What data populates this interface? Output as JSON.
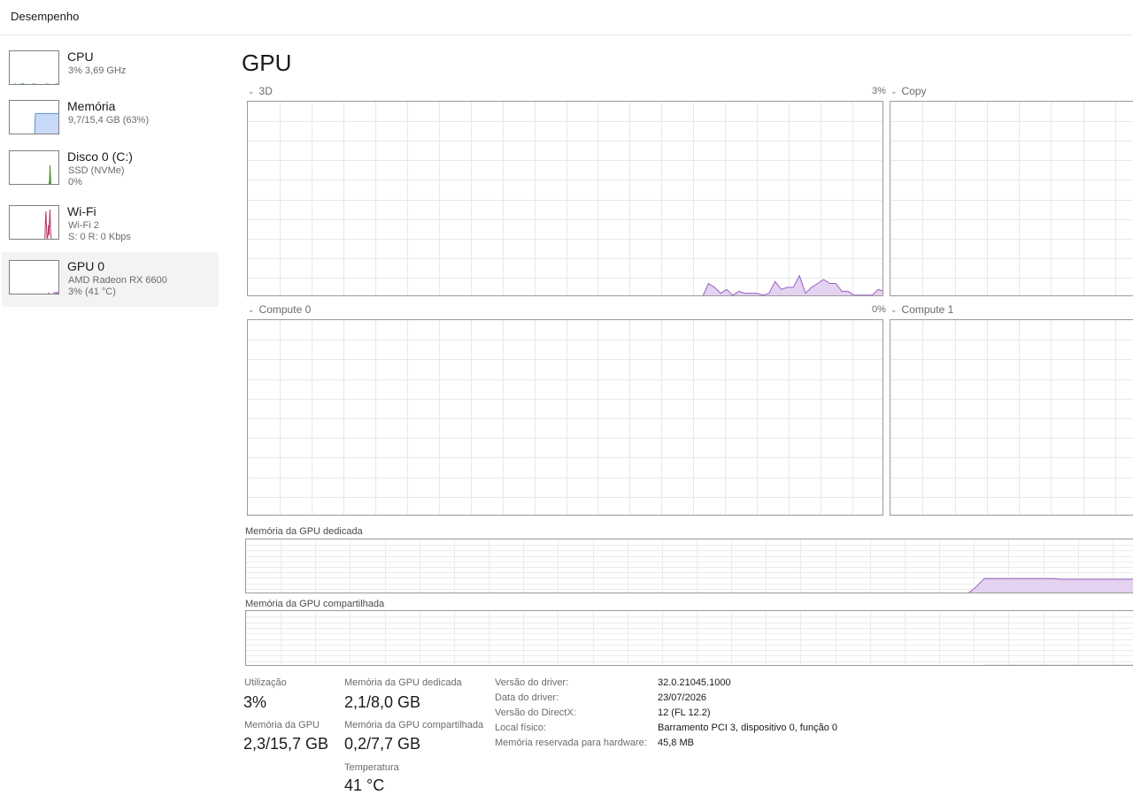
{
  "header": {
    "title": "Desempenho"
  },
  "sidebar": {
    "items": [
      {
        "name": "CPU",
        "sub1": "3% 3,69 GHz",
        "sub2": ""
      },
      {
        "name": "Memória",
        "sub1": "9,7/15,4 GB (63%)",
        "sub2": ""
      },
      {
        "name": "Disco 0 (C:)",
        "sub1": "SSD (NVMe)",
        "sub2": "0%"
      },
      {
        "name": "Wi-Fi",
        "sub1": "Wi-Fi 2",
        "sub2": "S: 0 R: 0 Kbps"
      },
      {
        "name": "GPU 0",
        "sub1": "AMD Radeon RX 6600",
        "sub2": "3% (41 °C)"
      }
    ]
  },
  "main": {
    "title": "GPU",
    "engines": [
      {
        "label": "3D",
        "percent": "3%"
      },
      {
        "label": "Copy",
        "percent": ""
      },
      {
        "label": "Compute 0",
        "percent": "0%"
      },
      {
        "label": "Compute 1",
        "percent": ""
      }
    ],
    "memory_graphs": {
      "dedicated_label": "Memória da GPU dedicada",
      "shared_label": "Memória da GPU compartilhada"
    }
  },
  "stats": {
    "utilization_label": "Utilização",
    "utilization_value": "3%",
    "dedicated_label": "Memória da GPU dedicada",
    "dedicated_value": "2,1/8,0 GB",
    "gpu_memory_label": "Memória da GPU",
    "gpu_memory_value": "2,3/15,7 GB",
    "shared_label": "Memória da GPU compartilhada",
    "shared_value": "0,2/7,7 GB",
    "temperature_label": "Temperatura",
    "temperature_value": "41 °C"
  },
  "info": [
    {
      "key": "Versão do driver:",
      "value": "32.0.21045.1000"
    },
    {
      "key": "Data do driver:",
      "value": "23/07/2026"
    },
    {
      "key": "Versão do DirectX:",
      "value": "12 (FL 12.2)"
    },
    {
      "key": "Local físico:",
      "value": "Barramento PCI 3, dispositivo 0, função 0"
    },
    {
      "key": "Memória reservada para hardware:",
      "value": "45,8 MB"
    }
  ],
  "history": {
    "gpu_3d_percent": [
      0,
      0,
      0,
      0,
      0,
      0,
      0,
      0,
      0,
      0,
      0,
      0,
      0,
      0,
      0,
      0,
      0,
      0,
      0,
      0,
      0,
      0,
      0,
      0,
      0,
      0,
      0,
      0,
      0,
      0,
      0,
      0,
      0,
      0,
      0,
      0,
      0,
      0,
      0,
      0,
      0,
      0,
      0,
      0,
      0,
      0,
      0,
      0,
      0,
      0,
      0,
      0,
      0,
      0,
      0,
      0,
      0,
      0,
      0,
      0,
      0,
      0,
      0,
      0,
      0,
      0,
      0,
      0,
      0,
      0,
      0,
      0,
      0,
      0,
      0,
      0,
      7,
      5,
      2,
      4,
      1,
      3,
      2,
      2,
      2,
      1,
      2,
      8,
      4,
      5,
      5,
      11,
      2,
      5,
      7,
      9,
      7,
      7,
      3,
      3,
      1,
      1,
      1,
      1,
      4,
      3
    ],
    "dedicated_memory_gb": [
      0,
      0,
      0,
      0,
      0,
      0,
      0,
      0,
      0,
      0,
      0,
      0,
      0,
      0,
      0,
      0,
      0,
      0,
      0,
      0,
      0,
      0,
      0,
      0,
      0,
      0,
      0,
      0,
      0,
      0,
      0,
      0,
      0,
      0,
      0,
      0,
      0,
      0,
      0,
      0,
      0,
      0,
      0,
      0,
      0,
      0,
      0,
      0,
      0,
      0,
      0,
      0,
      0,
      0,
      0,
      0,
      0,
      0,
      0,
      0,
      0,
      0,
      0,
      0,
      0,
      0,
      0,
      0,
      0,
      0,
      0,
      0,
      0,
      0,
      0,
      0,
      0,
      0,
      0,
      0,
      0,
      0,
      0,
      0,
      0,
      1,
      2.3,
      2.3,
      2.3,
      2.3,
      2.3,
      2.3,
      2.3,
      2.3,
      2.3,
      2.2,
      2.2,
      2.2,
      2.2,
      2.2,
      2.2,
      2.2,
      2.2,
      2.2,
      2.2,
      2.1
    ],
    "shared_memory_gb": [
      0,
      0,
      0,
      0,
      0,
      0,
      0,
      0,
      0,
      0,
      0,
      0,
      0,
      0,
      0,
      0,
      0,
      0,
      0,
      0,
      0,
      0,
      0,
      0,
      0,
      0,
      0,
      0,
      0,
      0,
      0,
      0,
      0,
      0,
      0,
      0,
      0,
      0,
      0,
      0,
      0,
      0,
      0,
      0,
      0,
      0,
      0,
      0,
      0,
      0,
      0,
      0,
      0,
      0,
      0,
      0,
      0,
      0,
      0,
      0,
      0,
      0,
      0,
      0,
      0,
      0,
      0,
      0,
      0,
      0,
      0,
      0,
      0,
      0,
      0,
      0,
      0,
      0,
      0,
      0,
      0,
      0,
      0,
      0,
      0,
      0,
      0.2,
      0.2,
      0.2,
      0.2,
      0.2,
      0.2,
      0.2,
      0.2,
      0.2,
      0.2,
      0.2,
      0.2,
      0.2,
      0.2,
      0.2,
      0.2,
      0.2,
      0.2,
      0.2,
      0.2
    ],
    "thumb_cpu_percent": [
      4,
      3,
      5,
      3,
      4,
      6,
      3,
      4,
      3,
      5,
      4,
      3,
      4,
      3,
      5,
      4,
      3,
      4,
      5,
      3
    ],
    "thumb_memory_percent": [
      0,
      0,
      0,
      0,
      0,
      0,
      0,
      0,
      0,
      0,
      0,
      0,
      0,
      0,
      0,
      0,
      0,
      0,
      0,
      0,
      0,
      0,
      0,
      0,
      0,
      0,
      0,
      0,
      0,
      0,
      63,
      63,
      63,
      63,
      63,
      63,
      63,
      63,
      63,
      63,
      63,
      63,
      63,
      63,
      63,
      63,
      63,
      63,
      63,
      63,
      63,
      63,
      63,
      63,
      63,
      63,
      63,
      63,
      63,
      63
    ],
    "thumb_disk_percent": [
      0,
      0,
      0,
      0,
      0,
      0,
      0,
      0,
      0,
      0,
      0,
      0,
      0,
      0,
      0,
      0,
      0,
      0,
      0,
      0,
      0,
      0,
      0,
      0,
      0,
      0,
      0,
      0,
      0,
      0,
      0,
      0,
      0,
      0,
      0,
      0,
      0,
      0,
      0,
      0,
      0,
      0,
      0,
      0,
      0,
      0,
      0,
      0,
      0,
      0,
      0,
      0,
      0,
      0,
      0,
      0,
      0,
      0,
      0,
      0,
      0,
      0,
      0,
      0,
      0,
      0,
      0,
      0,
      0,
      0,
      0,
      0,
      0,
      0,
      0,
      0,
      0,
      5,
      15,
      60,
      30,
      3,
      0,
      0,
      0,
      0,
      0,
      0,
      0,
      0,
      0,
      0,
      0,
      0,
      0,
      0,
      0,
      0,
      0,
      0
    ],
    "thumb_wifi_percent": [
      0,
      0,
      0,
      0,
      0,
      0,
      0,
      0,
      0,
      0,
      0,
      0,
      0,
      0,
      0,
      0,
      0,
      0,
      0,
      0,
      0,
      0,
      0,
      0,
      0,
      0,
      0,
      0,
      0,
      0,
      0,
      0,
      0,
      0,
      0,
      0,
      0,
      0,
      0,
      0,
      0,
      0,
      0,
      0,
      0,
      0,
      0,
      0,
      0,
      0,
      0,
      0,
      0,
      0,
      0,
      0,
      0,
      0,
      0,
      0,
      0,
      0,
      0,
      0,
      0,
      0,
      0,
      0,
      0,
      0,
      55,
      85,
      40,
      10,
      5,
      20,
      45,
      15,
      60,
      90,
      30,
      10,
      5,
      0,
      0,
      0,
      0,
      0,
      0,
      0,
      0,
      0,
      0,
      0,
      0,
      0,
      0,
      0,
      0,
      0
    ],
    "thumb_gpu_percent": [
      0,
      0,
      0,
      0,
      0,
      0,
      0,
      0,
      0,
      0,
      0,
      0,
      0,
      0,
      0,
      0,
      0,
      0,
      0,
      0,
      0,
      0,
      0,
      0,
      0,
      0,
      0,
      0,
      0,
      0,
      0,
      0,
      0,
      0,
      0,
      0,
      0,
      0,
      0,
      0,
      0,
      0,
      0,
      0,
      0,
      0,
      0,
      0,
      0,
      0,
      0,
      0,
      0,
      0,
      0,
      0,
      0,
      0,
      0,
      0,
      0,
      0,
      0,
      0,
      0,
      0,
      0,
      0,
      0,
      0,
      0,
      0,
      0,
      0,
      0,
      0,
      7,
      5,
      2,
      4,
      1,
      3,
      2,
      2,
      2,
      1,
      2,
      8,
      4,
      5,
      5,
      11,
      2,
      5,
      7,
      9,
      7,
      7,
      3,
      3
    ]
  },
  "colors": {
    "gpu": "#9b5fc0",
    "gpu_fill": "#e4d2f0",
    "cpu": "#1f8fc8",
    "memory": "#6e3ea8",
    "memory_fill": "#c9daf8",
    "memory_stroke": "#5b8ed6",
    "disk": "#5b9a3c",
    "wifi": "#b4356a"
  }
}
